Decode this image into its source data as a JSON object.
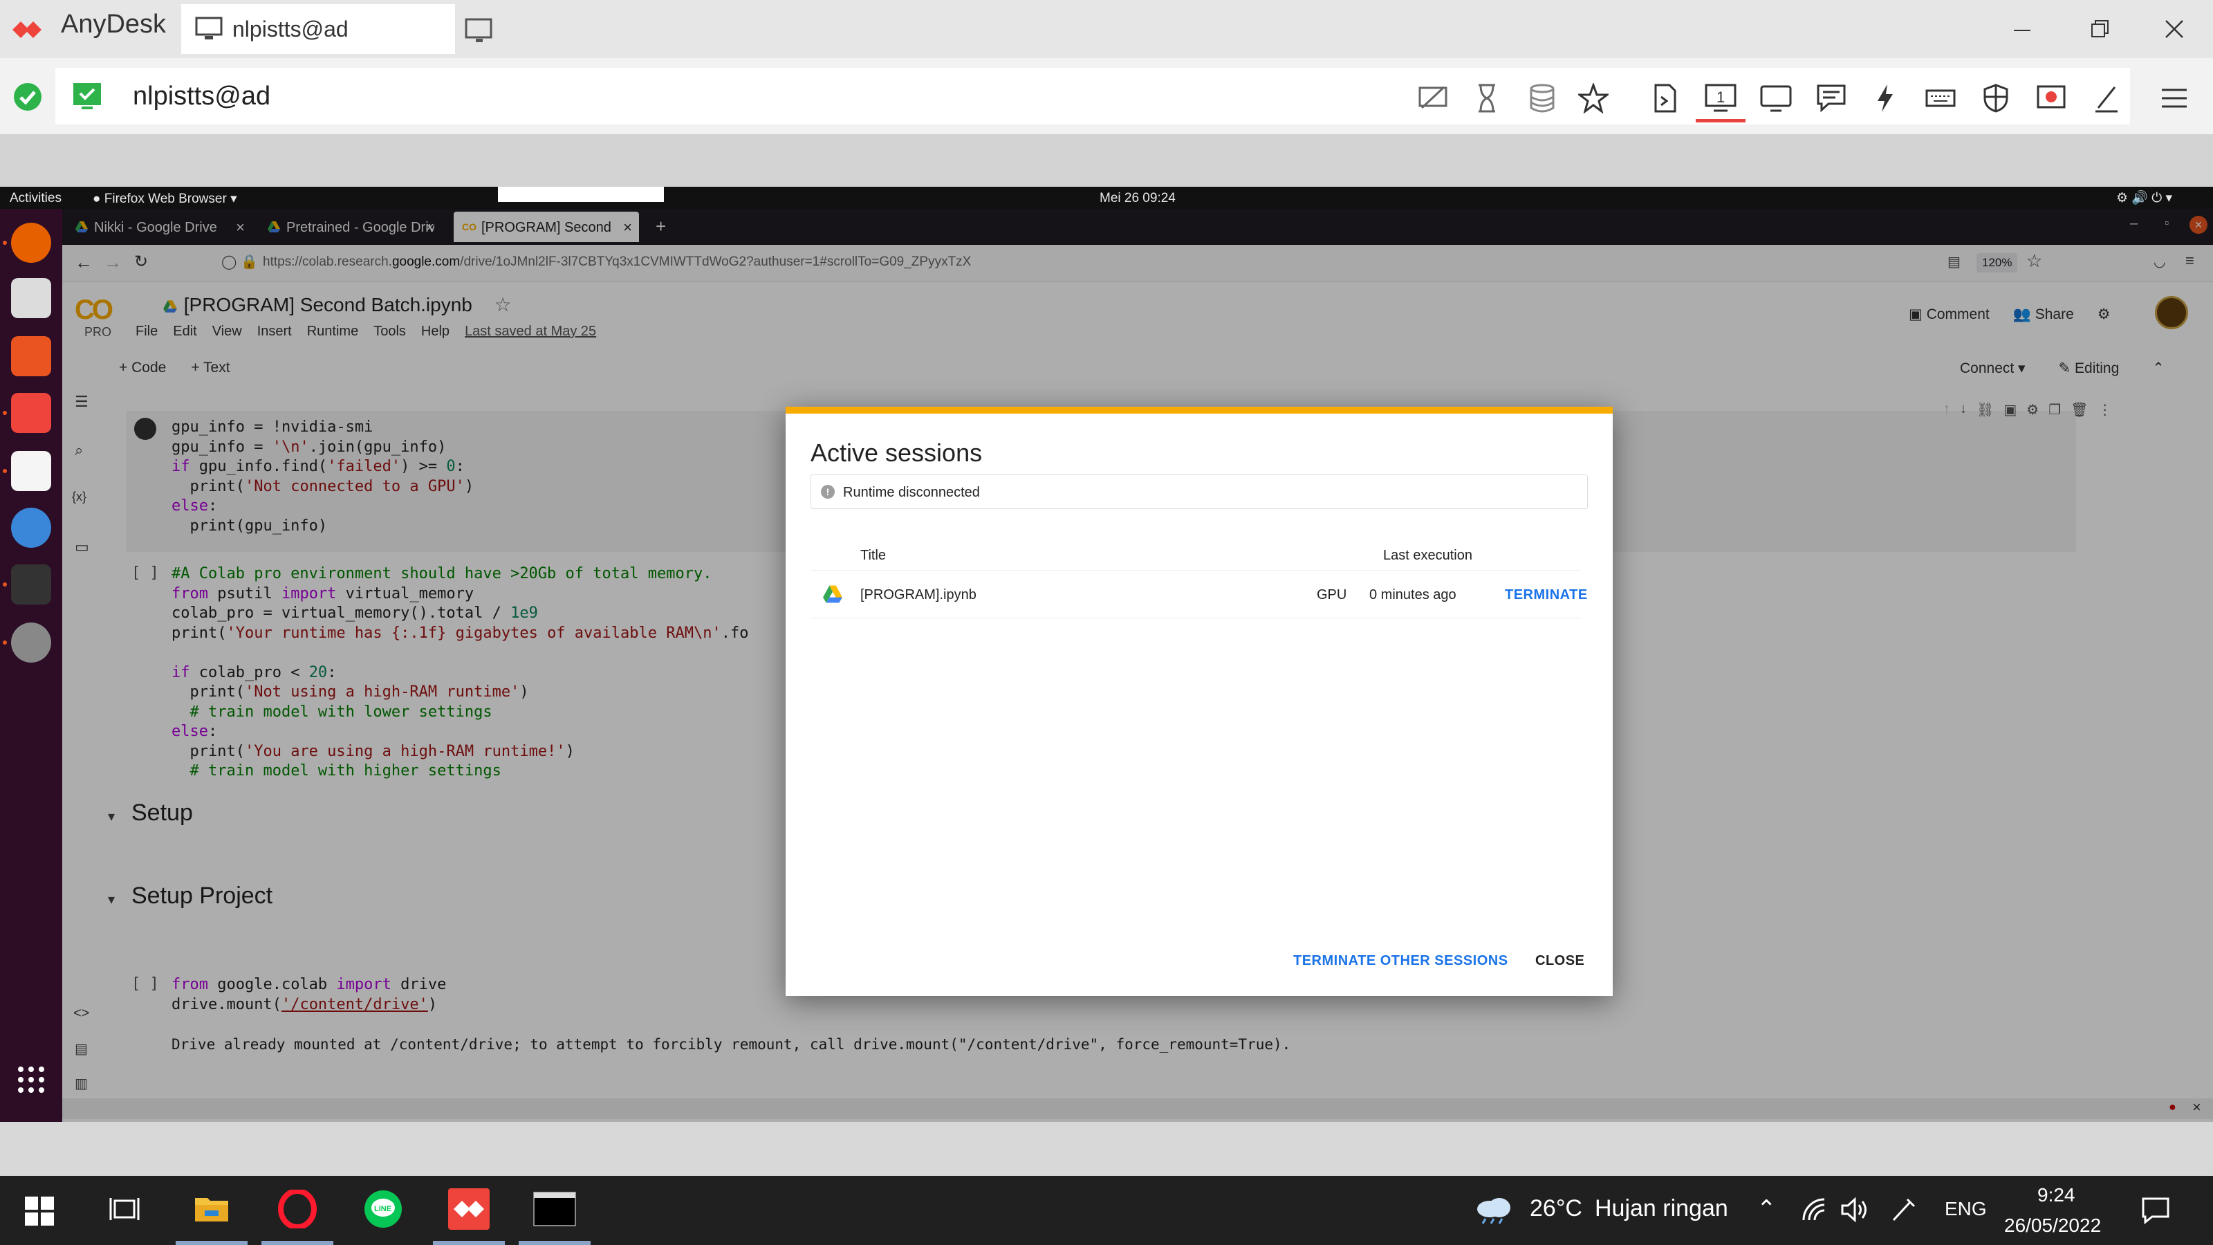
{
  "anydesk": {
    "brand": "AnyDesk",
    "tab_label": "nlpistts@ad",
    "address": "nlpistts@ad",
    "accent": "#e8423f"
  },
  "gnome": {
    "activities": "Activities",
    "app": "Firefox Web Browser",
    "clock": "Mei 26  09:24"
  },
  "firefox": {
    "tabs": [
      {
        "title": "Nikki - Google Drive"
      },
      {
        "title": "Pretrained - Google Drive"
      },
      {
        "title": "[PROGRAM] Second Batc"
      }
    ],
    "url_prefix": "https://colab.research.",
    "url_domain": "google.com",
    "url_rest": "/drive/1oJMnl2lF-3l7CBTYq3x1CVMIWTTdWoG2?authuser=1#scrollTo=G09_ZPyyxTzX",
    "zoom": "120%"
  },
  "colab": {
    "logo": "CO",
    "pro": "PRO",
    "title": "[PROGRAM] Second Batch.ipynb",
    "menu": [
      "File",
      "Edit",
      "View",
      "Insert",
      "Runtime",
      "Tools",
      "Help"
    ],
    "last_saved": "Last saved at May 25",
    "comment": "Comment",
    "share": "Share",
    "add_code": "+ Code",
    "add_text": "+ Text",
    "connect": "Connect",
    "editing": "Editing",
    "section_setup": "Setup",
    "section_setup_project": "Setup Project",
    "drive_output": "Drive already mounted at /content/drive; to attempt to forcibly remount, call drive.mount(\"/content/drive\", force_remount=True).",
    "bracket": "[ ]"
  },
  "dialog": {
    "title": "Active sessions",
    "notice": "Runtime disconnected",
    "col_title": "Title",
    "col_last": "Last execution",
    "session_name": "[PROGRAM].ipynb",
    "session_type": "GPU",
    "session_time": "0 minutes ago",
    "terminate": "TERMINATE",
    "terminate_others": "TERMINATE OTHER SESSIONS",
    "close": "CLOSE",
    "accent": "#f9ab00"
  },
  "taskbar": {
    "temp": "26°C",
    "weather": "Hujan ringan",
    "lang": "ENG",
    "time": "9:24",
    "date": "26/05/2022"
  }
}
